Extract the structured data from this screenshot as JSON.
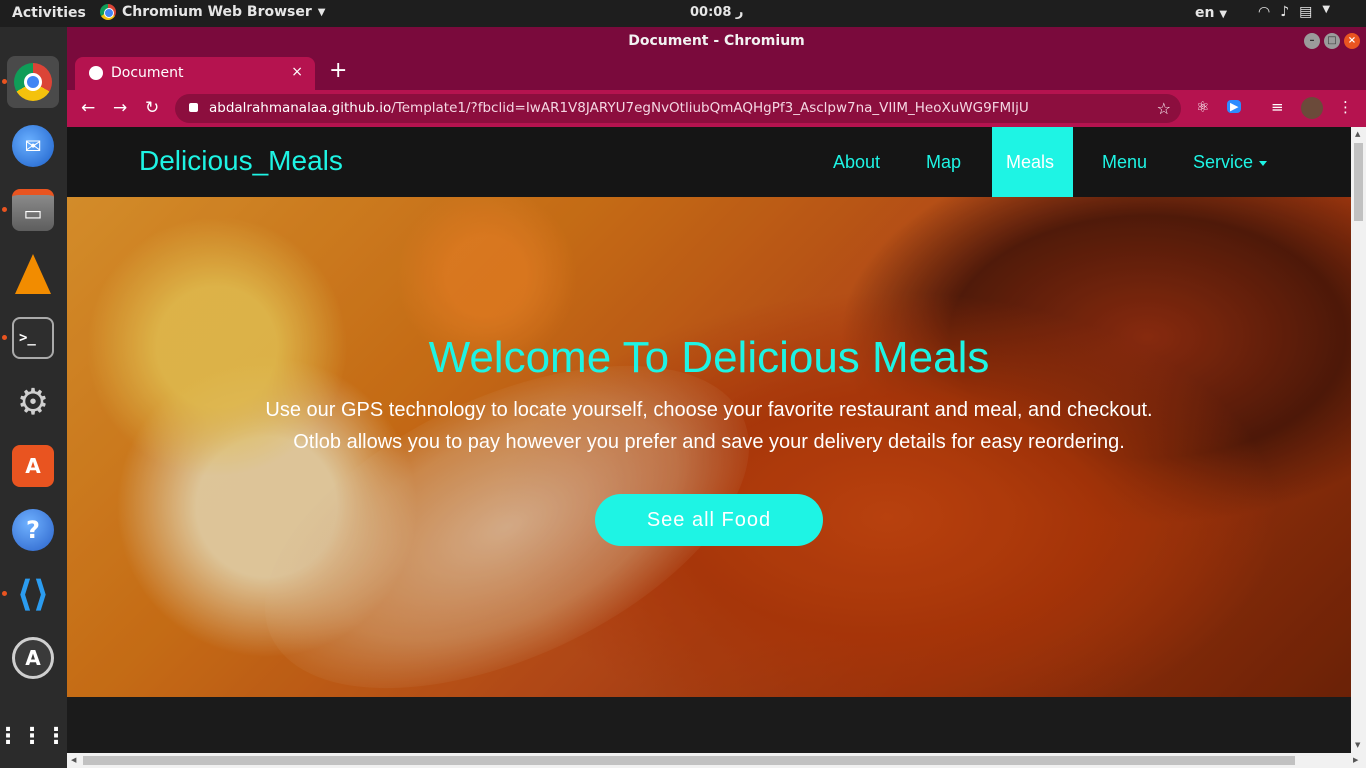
{
  "system": {
    "activities": "Activities",
    "app_menu": "Chromium Web Browser",
    "clock": "ر 00:08",
    "language": "en"
  },
  "window": {
    "title": "Document - Chromium"
  },
  "tab": {
    "title": "Document",
    "close": "×",
    "new_tab": "+"
  },
  "address_bar": {
    "host": "abdalrahmanalaa.github.io",
    "path": "/Template1/?fbclid=IwAR1V8JARYU7egNvOtliubQmAQHgPf3_Asclpw7na_VIIM_HeoXuWG9FMIjU"
  },
  "site": {
    "brand": "Delicious_Meals",
    "nav": [
      {
        "label": "About"
      },
      {
        "label": "Map"
      },
      {
        "label": "Meals"
      },
      {
        "label": "Menu"
      },
      {
        "label": "Service"
      }
    ],
    "active_nav": "Meals",
    "hero": {
      "title": "Welcome To Delicious Meals",
      "text_line1": "Use our GPS technology to locate yourself, choose your favorite restaurant and meal, and checkout.",
      "text_line2": "Otlob allows you to pay however you prefer and save your delivery details for easy reordering.",
      "button": "See all Food"
    },
    "accent_color": "#1ef4e4"
  },
  "colors": {
    "browser_frame": "#7a0a3c",
    "browser_toolbar": "#b5134f"
  }
}
